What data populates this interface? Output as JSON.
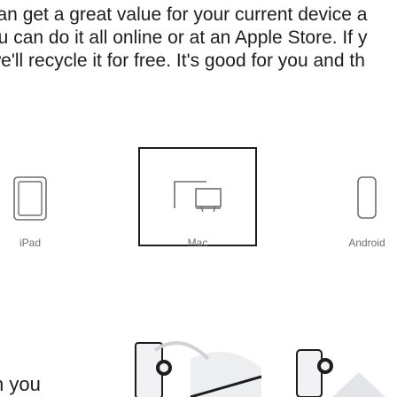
{
  "intro": {
    "line1": "can get a great value for your current device a",
    "line2": "ou can do it all online or at an Apple Store. If y",
    "line3": "we'll recycle it for free. It's good for you and th"
  },
  "devices": [
    {
      "label": "iPad",
      "icon": "ipad-icon",
      "selected": false
    },
    {
      "label": "Mac",
      "icon": "mac-icon",
      "selected": true
    },
    {
      "label": "Android",
      "icon": "android-phone-icon",
      "selected": false
    }
  ],
  "footer": {
    "text": "n you"
  }
}
